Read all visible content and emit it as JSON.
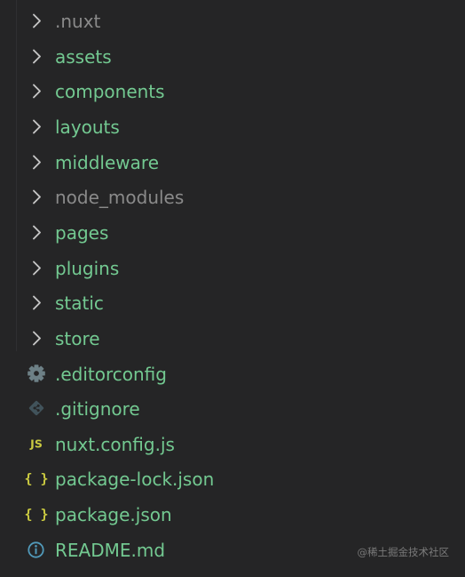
{
  "explorer": {
    "items": [
      {
        "label": ".nuxt",
        "kind": "folder",
        "icon": "chevron-right-icon",
        "color": "#8a8a8a"
      },
      {
        "label": "assets",
        "kind": "folder",
        "icon": "chevron-right-icon",
        "color": "#73c991"
      },
      {
        "label": "components",
        "kind": "folder",
        "icon": "chevron-right-icon",
        "color": "#73c991"
      },
      {
        "label": "layouts",
        "kind": "folder",
        "icon": "chevron-right-icon",
        "color": "#73c991"
      },
      {
        "label": "middleware",
        "kind": "folder",
        "icon": "chevron-right-icon",
        "color": "#73c991"
      },
      {
        "label": "node_modules",
        "kind": "folder",
        "icon": "chevron-right-icon",
        "color": "#8a8a8a"
      },
      {
        "label": "pages",
        "kind": "folder",
        "icon": "chevron-right-icon",
        "color": "#73c991"
      },
      {
        "label": "plugins",
        "kind": "folder",
        "icon": "chevron-right-icon",
        "color": "#73c991"
      },
      {
        "label": "static",
        "kind": "folder",
        "icon": "chevron-right-icon",
        "color": "#73c991"
      },
      {
        "label": "store",
        "kind": "folder",
        "icon": "chevron-right-icon",
        "color": "#73c991"
      },
      {
        "label": ".editorconfig",
        "kind": "file",
        "icon": "gear-icon",
        "color": "#73c991"
      },
      {
        "label": ".gitignore",
        "kind": "file",
        "icon": "git-icon",
        "color": "#73c991"
      },
      {
        "label": "nuxt.config.js",
        "kind": "file",
        "icon": "js-icon",
        "color": "#73c991"
      },
      {
        "label": "package-lock.json",
        "kind": "file",
        "icon": "json-braces-icon",
        "color": "#73c991"
      },
      {
        "label": "package.json",
        "kind": "file",
        "icon": "json-braces-icon",
        "color": "#73c991"
      },
      {
        "label": "README.md",
        "kind": "file",
        "icon": "info-icon",
        "color": "#73c991"
      }
    ]
  },
  "icon_colors": {
    "chevron": "#c5c5c5",
    "gear": "#6d8086",
    "git": "#41535b",
    "js": "#cbcb41",
    "json": "#cbcb41",
    "info": "#519aba"
  },
  "watermark": {
    "text": "@稀土掘金技术社区",
    "color": "#7a7a7a"
  }
}
